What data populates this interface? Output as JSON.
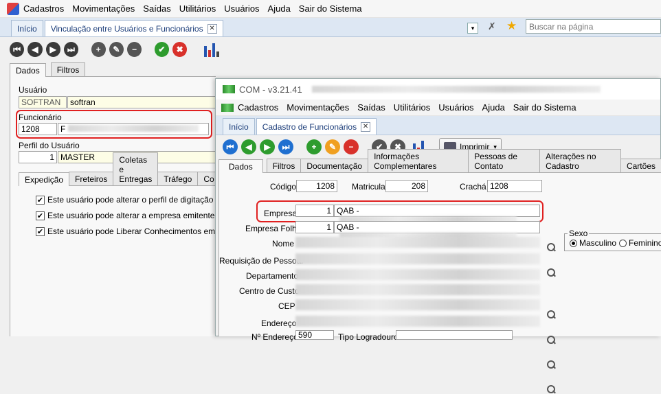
{
  "main_menu": {
    "items": [
      "Cadastros",
      "Movimentações",
      "Saídas",
      "Utilitários",
      "Usuários",
      "Ajuda",
      "Sair do Sistema"
    ]
  },
  "main_tabs": [
    {
      "label": "Início"
    },
    {
      "label": "Vinculação entre Usuários e Funcionários"
    }
  ],
  "search": {
    "placeholder": "Buscar na página"
  },
  "bg_form": {
    "subtabs": [
      "Dados",
      "Filtros"
    ],
    "usuario_label": "Usuário",
    "usuario_code": "SOFTRAN",
    "usuario_name": "softran",
    "funcionario_label": "Funcionário",
    "funcionario_code": "1208",
    "funcionario_name_prefix": "F",
    "perfil_label": "Perfil do Usuário",
    "perfil_code": "1",
    "perfil_name": "MASTER",
    "section_tabs": [
      "Expedição",
      "Freteiros",
      "Coletas e Entregas",
      "Tráfego",
      "Co"
    ],
    "checks": [
      "Este usuário pode alterar o perfil de digitação na en",
      "Este usuário pode alterar a empresa emitente na en",
      "Este usuário pode Liberar Conhecimentos emitidos"
    ]
  },
  "child_window": {
    "title": "COM - v3.21.41",
    "menu": [
      "Cadastros",
      "Movimentações",
      "Saídas",
      "Utilitários",
      "Usuários",
      "Ajuda",
      "Sair do Sistema"
    ],
    "tabs": [
      {
        "label": "Início"
      },
      {
        "label": "Cadastro de Funcionários"
      }
    ],
    "print_label": "Imprimir",
    "subtabs": [
      "Dados",
      "Filtros",
      "Documentação",
      "Informações Complementares",
      "Pessoas de Contato",
      "Alterações no Cadastro",
      "Cartões"
    ],
    "codigo_label": "Código",
    "codigo_value": "1208",
    "matricula_label": "Matricula",
    "matricula_value": "208",
    "cracha_label": "Crachá",
    "cracha_value": "1208",
    "empresa_label": "Empresa",
    "empresa_code": "1",
    "empresa_name": "QAB -",
    "empresa_folha_label": "Empresa Folha",
    "empresa_folha_code": "1",
    "empresa_folha_name": "QAB -",
    "nome_label": "Nome",
    "requisicao_label": "Requisição de Pessoal",
    "departamento_label": "Departamento",
    "centro_custo_label": "Centro de Custo",
    "cep_label": "CEP",
    "endereco_label": "Endereço",
    "numero_label": "Nº Endereço",
    "numero_value": "590",
    "tipo_logradouro_label": "Tipo Logradouro",
    "sexo_label": "Sexo",
    "sexo_options": [
      "Masculino",
      "Feminino"
    ]
  }
}
